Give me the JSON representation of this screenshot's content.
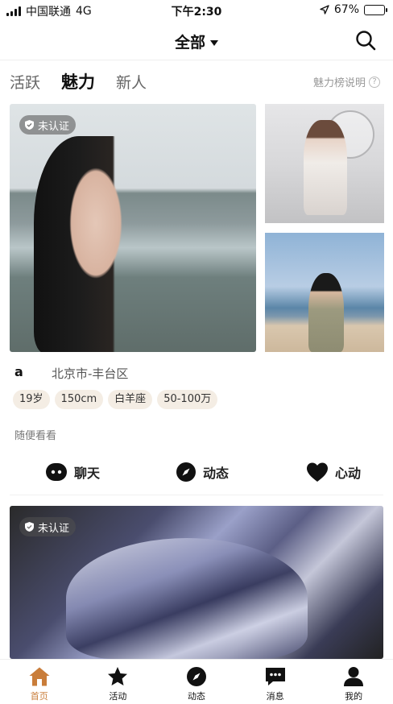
{
  "status_bar": {
    "carrier": "中国联通",
    "network": "4G",
    "time": "下午2:30",
    "battery": "67%",
    "battery_level": 0.67
  },
  "header": {
    "title": "全部",
    "search_icon": "search-icon"
  },
  "tabs": [
    {
      "label": "活跃",
      "active": false
    },
    {
      "label": "魅力",
      "active": true
    },
    {
      "label": "新人",
      "active": false
    }
  ],
  "charm_help": {
    "label": "魅力榜说明",
    "icon": "question-icon"
  },
  "card1": {
    "badge": "未认证",
    "name": "a",
    "location": "北京市-丰台区",
    "tags": [
      "19岁",
      "150cm",
      "白羊座",
      "50-100万"
    ],
    "caption": "随便看看",
    "actions": [
      {
        "label": "聊天",
        "icon": "chat-icon"
      },
      {
        "label": "动态",
        "icon": "compass-icon"
      },
      {
        "label": "心动",
        "icon": "heart-icon"
      }
    ]
  },
  "card2": {
    "badge": "未认证"
  },
  "bottom_nav": [
    {
      "label": "首页",
      "icon": "home-icon",
      "active": true
    },
    {
      "label": "活动",
      "icon": "star-icon",
      "active": false
    },
    {
      "label": "动态",
      "icon": "compass-icon",
      "active": false
    },
    {
      "label": "消息",
      "icon": "message-icon",
      "active": false
    },
    {
      "label": "我的",
      "icon": "user-icon",
      "active": false
    }
  ],
  "colors": {
    "accent": "#c97d3a",
    "tag_bg": "#f4ede4",
    "text": "#111111"
  }
}
